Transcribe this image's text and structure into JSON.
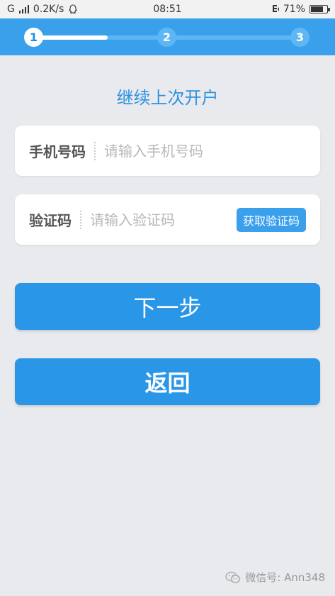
{
  "status_bar": {
    "network": "G",
    "speed": "0.2K/s",
    "time": "08:51",
    "battery": "71%"
  },
  "progress": {
    "steps": [
      "1",
      "2",
      "3"
    ],
    "current_step": 1
  },
  "page": {
    "title": "继续上次开户"
  },
  "form": {
    "phone": {
      "label": "手机号码",
      "placeholder": "请输入手机号码"
    },
    "code": {
      "label": "验证码",
      "placeholder": "请输入验证码",
      "button": "获取验证码"
    }
  },
  "actions": {
    "next": "下一步",
    "back": "返回"
  },
  "watermark": {
    "text": "微信号: Ann348"
  },
  "colors": {
    "primary": "#2a96e8",
    "header": "#3aa0ec",
    "title": "#2b92df",
    "background": "#e9eaee"
  }
}
